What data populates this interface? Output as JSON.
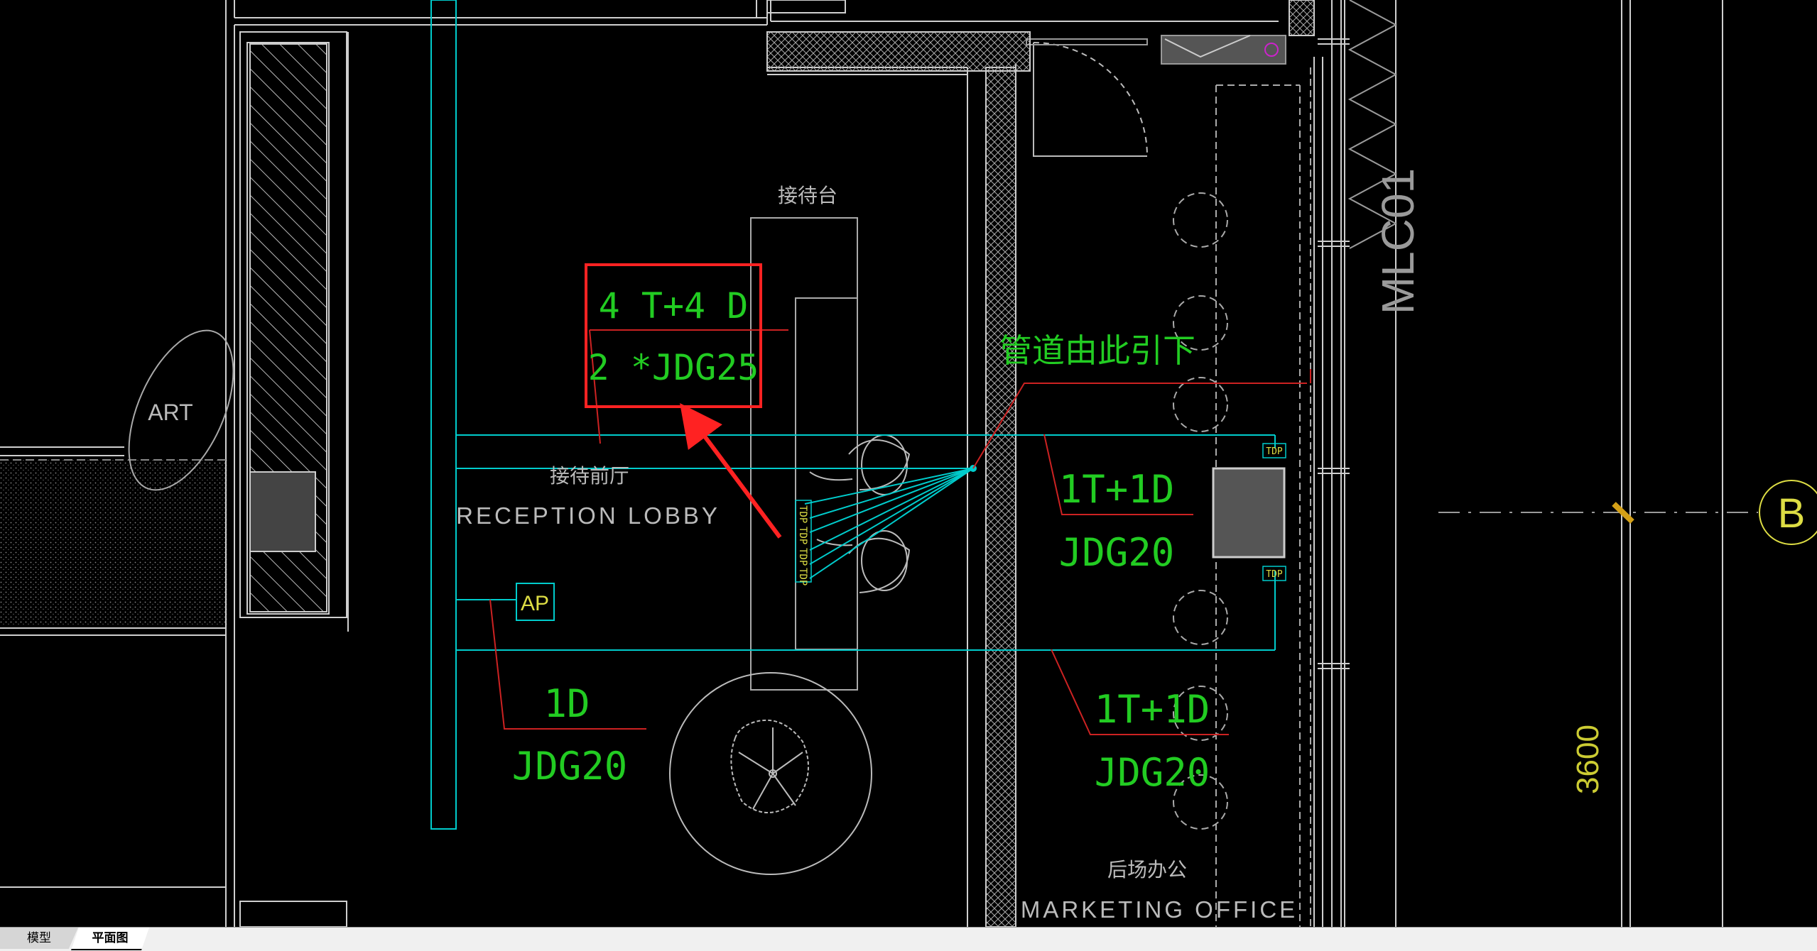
{
  "tabs": [
    {
      "label": "模型",
      "active": false
    },
    {
      "label": "平面图",
      "active": true
    }
  ],
  "drawing": {
    "labels": {
      "reception_desk": "接待台",
      "pipe_from_here": "管道由此引下",
      "lobby_cn": "接待前厅",
      "lobby_en": "RECEPTION LOBBY",
      "office_cn": "后场办公",
      "office_en": "MARKETING OFFICE",
      "art": "ART",
      "access_point": "AP",
      "window_tag": "MLC01",
      "dimension": "3600",
      "grid_axis": "B",
      "tdp_outlet": "TDP"
    },
    "annotations": {
      "highlighted": {
        "line1": "4 T+4 D",
        "line2": "2 *JDG25"
      },
      "right_upper": {
        "line1": "1T+1D",
        "line2": "JDG20"
      },
      "right_lower": {
        "line1": "1T+1D",
        "line2": "JDG20"
      },
      "left_lower": {
        "line1": "1D",
        "line2": "JDG20"
      }
    }
  },
  "colors": {
    "background": "#000000",
    "wall": "#ffffff",
    "cable": "#00cccc",
    "annotation_text": "#22cc22",
    "leader": "#cc2222",
    "highlight_box": "#ff2222",
    "dimension_text": "#cccc33",
    "label_text": "#cccccc"
  }
}
